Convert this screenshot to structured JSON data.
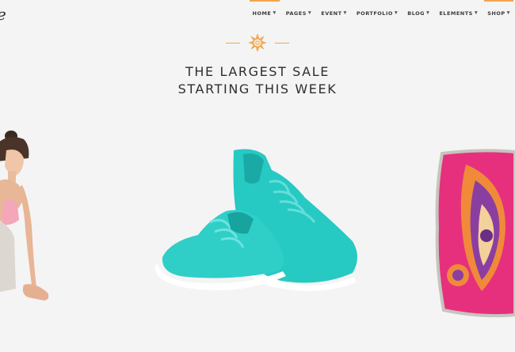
{
  "header": {
    "logo_text": "e",
    "nav": [
      {
        "label": "HOME",
        "active": true
      },
      {
        "label": "PAGES",
        "active": false
      },
      {
        "label": "EVENT",
        "active": false
      },
      {
        "label": "PORTFOLIO",
        "active": false
      },
      {
        "label": "BLOG",
        "active": false
      },
      {
        "label": "ELEMENTS",
        "active": false
      },
      {
        "label": "SHOP",
        "active": true
      }
    ],
    "accent_color": "#f2a44e"
  },
  "hero": {
    "headline_line1": "THE LARGEST SALE",
    "headline_line2": "STARTING THIS WEEK",
    "ornament_icon": "sun-ornament-icon"
  },
  "images": [
    {
      "name": "woman-model-image"
    },
    {
      "name": "teal-sneakers-image"
    },
    {
      "name": "paisley-pillow-image"
    }
  ]
}
